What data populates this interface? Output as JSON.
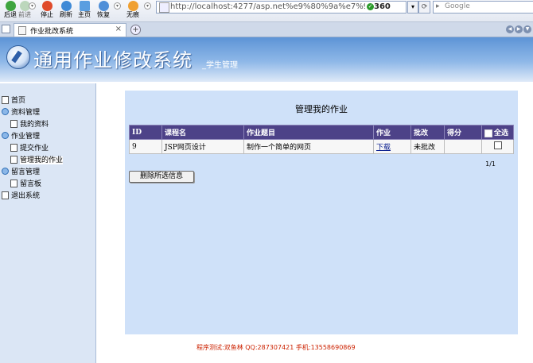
{
  "browser": {
    "toolbar_buttons": [
      {
        "label": "后退"
      },
      {
        "label": "前进"
      },
      {
        "label": "停止"
      },
      {
        "label": "刷新"
      },
      {
        "label": "主页"
      },
      {
        "label": "恢复"
      },
      {
        "label": "无痕"
      }
    ],
    "address": "http://localhost:4277/asp.net%e9%80%9a%e7%94%a",
    "security_badge": "360",
    "search_placeholder": "Google",
    "tab_title": "作业批改系统",
    "tab_close": "×",
    "new_tab": "+"
  },
  "header": {
    "title": "通用作业修改系统",
    "subtitle": "_学生管理"
  },
  "sidebar": {
    "items": [
      {
        "label": "首页",
        "level": 0,
        "icon": "page-icon"
      },
      {
        "label": "资料管理",
        "level": 0,
        "icon": "folder-icon"
      },
      {
        "label": "我的资料",
        "level": 1,
        "icon": "page-icon"
      },
      {
        "label": "作业管理",
        "level": 0,
        "icon": "folder-icon"
      },
      {
        "label": "提交作业",
        "level": 1,
        "icon": "page-icon"
      },
      {
        "label": "管理我的作业",
        "level": 1,
        "icon": "page-icon",
        "active": true
      },
      {
        "label": "留言管理",
        "level": 0,
        "icon": "folder-icon"
      },
      {
        "label": "留言板",
        "level": 1,
        "icon": "page-icon"
      },
      {
        "label": "退出系统",
        "level": 0,
        "icon": "page-icon"
      }
    ]
  },
  "main": {
    "title": "管理我的作业",
    "table": {
      "headers": [
        "ID",
        "课程名",
        "作业题目",
        "作业",
        "批改",
        "得分",
        "全选"
      ],
      "rows": [
        {
          "id": "9",
          "course": "JSP网页设计",
          "topic": "制作一个简单的网页",
          "file": "下载",
          "status": "未批改",
          "score": "",
          "checked": false
        }
      ]
    },
    "pager": "1/1",
    "delete_button": "删除所选信息"
  },
  "footer": "程序测试:双鱼林 QQ:287307421 手机:13558690869",
  "colors": {
    "table_header_bg": "#4d4288",
    "content_bg": "#cfe1f9",
    "sidebar_bg": "#dbe6f5",
    "footer_text": "#cc2200"
  }
}
